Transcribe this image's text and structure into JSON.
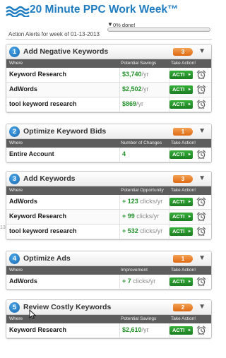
{
  "header": {
    "title": "20 Minute PPC Work Week™",
    "logo_icon": "waves-logo-icon",
    "progress": {
      "percent": 0,
      "text": "0% done!"
    },
    "week_line": "Action Alerts for week of 01-13-2013"
  },
  "side_scrap": "13",
  "colors": {
    "accent": "#1e7cc1",
    "positive": "#23922a",
    "badge": "#e06a13",
    "action": "#2a9a2f"
  },
  "sections": [
    {
      "number": "1",
      "title": "Add Negative Keywords",
      "count": "3",
      "columns": [
        "Where",
        "Potential Savings",
        "Take Action!"
      ],
      "rows": [
        {
          "where": "Keyword Research",
          "value": "$3,740",
          "unit": "/yr",
          "action": "ACTI"
        },
        {
          "where": "AdWords",
          "value": "$2,502",
          "unit": "/yr",
          "action": "ACTI"
        },
        {
          "where": "tool keyword research",
          "value": "$869",
          "unit": "/yr",
          "action": "ACTI"
        }
      ]
    },
    {
      "number": "2",
      "title": "Optimize Keyword Bids",
      "count": "1",
      "columns": [
        "Where",
        "Number of Changes",
        "Take Action!"
      ],
      "rows": [
        {
          "where": "Entire Account",
          "value": "4",
          "unit": "",
          "action": "ACTI"
        }
      ]
    },
    {
      "number": "3",
      "title": "Add Keywords",
      "count": "3",
      "columns": [
        "Where",
        "Potential Opportunity",
        "Take Action!"
      ],
      "rows": [
        {
          "where": "AdWords",
          "value": "+ 123",
          "unit": " clicks/yr",
          "action": "ACTI"
        },
        {
          "where": "Keyword Research",
          "value": "+ 99",
          "unit": " clicks/yr",
          "action": "ACTI"
        },
        {
          "where": "tool keyword research",
          "value": "+ 532",
          "unit": " clicks/yr",
          "action": "ACTI"
        }
      ]
    },
    {
      "number": "4",
      "title": "Optimize Ads",
      "count": "1",
      "columns": [
        "Where",
        "Improvement",
        "Take Action!"
      ],
      "rows": [
        {
          "where": "AdWords",
          "value": "+ 7",
          "unit": " clicks/yr",
          "action": "ACTI"
        }
      ]
    },
    {
      "number": "5",
      "title": "Review Costly Keywords",
      "count": "2",
      "columns": [
        "Where",
        "Potential Savings",
        "Take Action!"
      ],
      "rows": [
        {
          "where": "Keyword Research",
          "value": "$2,610",
          "unit": "/yr",
          "action": "ACTI"
        }
      ]
    }
  ]
}
